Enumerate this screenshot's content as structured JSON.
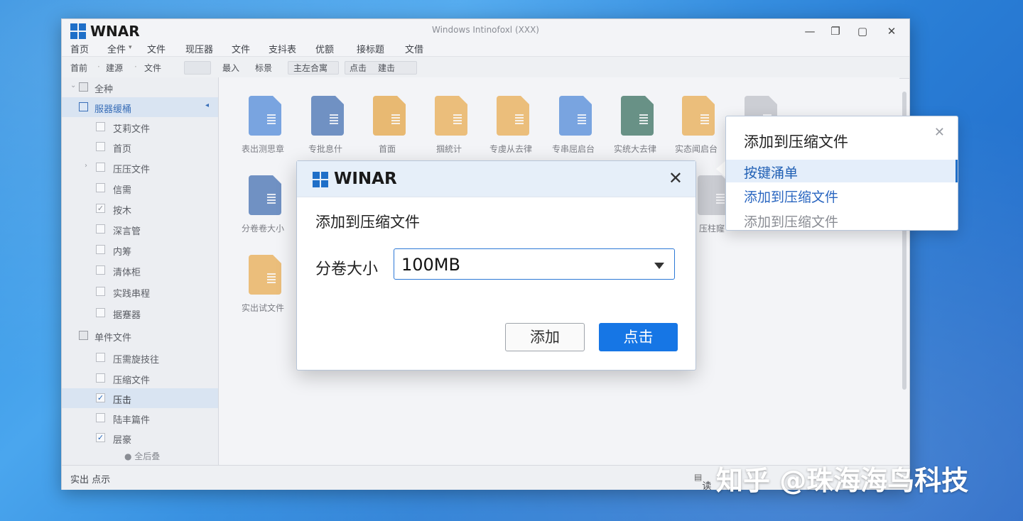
{
  "window": {
    "brand": "WNAR",
    "title": "Windows Intinofoxl (XXX)",
    "controls": {
      "minimize": "—",
      "restore": "❐",
      "maximize": "▢",
      "close": "✕"
    }
  },
  "menubar": [
    "首页",
    "全件",
    "文件",
    "现压器",
    "文件",
    "支抖表",
    "优额",
    "接标题",
    "文借"
  ],
  "toolbar": {
    "nav": [
      "首前",
      "建源",
      "文件"
    ],
    "view": [
      "最入",
      "标景"
    ],
    "actions": [
      "主左合寓",
      "点击",
      "建击"
    ]
  },
  "sidebar": [
    {
      "label": "全种",
      "type": "header"
    },
    {
      "label": "服器缓桶",
      "type": "folder",
      "selected": true
    },
    {
      "label": "艾莉文件",
      "checked": false
    },
    {
      "label": "首页",
      "checked": false
    },
    {
      "label": "压压文件",
      "checked": false
    },
    {
      "label": "信需",
      "checked": false
    },
    {
      "label": "按木",
      "checked": true
    },
    {
      "label": "深言管",
      "checked": false
    },
    {
      "label": "内筹",
      "checked": false
    },
    {
      "label": "清体柜",
      "checked": false
    },
    {
      "label": "实践串程",
      "checked": false
    },
    {
      "label": "据蹇器",
      "checked": false
    },
    {
      "label": "单件文件",
      "type": "header"
    },
    {
      "label": "压需旋技往",
      "checked": false
    },
    {
      "label": "压缩文件",
      "checked": false
    },
    {
      "label": "压击",
      "checked": true,
      "selected": true
    },
    {
      "label": "陆丰篇件",
      "checked": false
    },
    {
      "label": "层豪",
      "checked": true
    },
    {
      "label": "全后叠",
      "type": "footer"
    }
  ],
  "files": [
    {
      "name": "表出测思章",
      "color": "#3a7bd5"
    },
    {
      "name": "专批息什",
      "color": "#2c5fa8"
    },
    {
      "name": "首面",
      "color": "#e39b2c"
    },
    {
      "name": "掴統计",
      "color": "#e8a43a"
    },
    {
      "name": "专虔从去律",
      "color": "#e8a43a"
    },
    {
      "name": "专串屈启台",
      "color": "#3a7bd5"
    },
    {
      "name": "实统大去律",
      "color": "#1f5e4a"
    },
    {
      "name": "实态闻启台",
      "color": "#e8a43a"
    },
    {
      "name": "",
      "color": "#b9bcc2"
    },
    {
      "name": "分卷卷大小",
      "color": "#2c5fa8"
    },
    {
      "name": "压柱窿",
      "color": "#b9bcc2"
    },
    {
      "name": "实出试文件",
      "color": "#e8a43a"
    }
  ],
  "statusbar": {
    "left": "实出 点示",
    "right": "读"
  },
  "dialog": {
    "brand": "WINAR",
    "close": "✕",
    "heading": "添加到压缩文件",
    "volume_label": "分卷大小",
    "volume_value": "100MB",
    "btn_add": "添加",
    "btn_click": "点击"
  },
  "popup": {
    "title": "添加到压缩文件",
    "close": "✕",
    "items": [
      {
        "label": "按键涌单",
        "highlight": true,
        "color": "#1f5fb4"
      },
      {
        "label": "添加到压缩文件",
        "highlight": false,
        "color": "#2a66c0"
      },
      {
        "label": "添加到压缩文件",
        "highlight": false,
        "color": "#8a8d94"
      }
    ]
  },
  "watermark": "知乎 @珠海海鸟科技"
}
